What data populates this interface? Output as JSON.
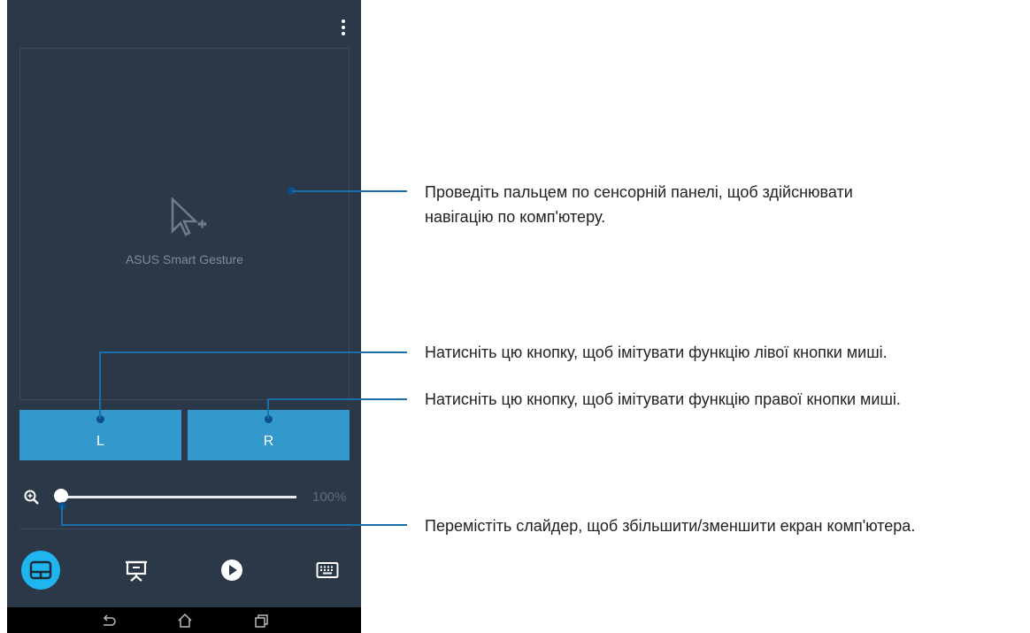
{
  "app": {
    "touchpad_label": "ASUS Smart Gesture",
    "left_button": "L",
    "right_button": "R",
    "zoom_value": "100%",
    "zoom_level_fraction": 0.0,
    "accent_color": "#1fb6f0",
    "button_color": "#3399cc",
    "background_color": "#2b3847",
    "tabs": [
      {
        "icon": "touchpad-icon",
        "active": true
      },
      {
        "icon": "presentation-icon",
        "active": false
      },
      {
        "icon": "play-icon",
        "active": false
      },
      {
        "icon": "keyboard-icon",
        "active": false
      }
    ],
    "navbar": [
      "back-icon",
      "home-icon",
      "recent-apps-icon"
    ]
  },
  "callouts": {
    "touchpad": "Проведіть пальцем по сенсорній панелі, щоб здійснювати навігацію по комп'ютеру.",
    "left_button": "Натисніть цю кнопку, щоб імітувати функцію лівої кнопки миші.",
    "right_button": "Натисніть цю кнопку, щоб імітувати функцію правої кнопки миші.",
    "slider": "Перемістіть слайдер, щоб збільшити/зменшити екран комп'ютера."
  }
}
